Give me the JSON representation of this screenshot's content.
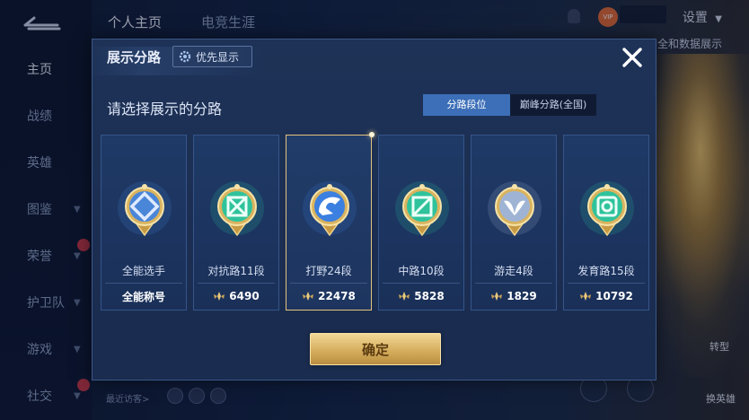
{
  "background": {
    "top_tabs": [
      "个人主页",
      "电竞生涯"
    ],
    "settings_label": "设置",
    "ticker_text": "",
    "peek_text": "全和数据展示",
    "nav_items": [
      {
        "label": "主页",
        "active": true,
        "chevron": false,
        "new": false
      },
      {
        "label": "战绩",
        "active": false,
        "chevron": false,
        "new": false
      },
      {
        "label": "英雄",
        "active": false,
        "chevron": false,
        "new": false
      },
      {
        "label": "图鉴",
        "active": false,
        "chevron": true,
        "new": false
      },
      {
        "label": "荣誉",
        "active": false,
        "chevron": true,
        "new": true
      },
      {
        "label": "护卫队",
        "active": false,
        "chevron": true,
        "new": false
      },
      {
        "label": "游戏",
        "active": false,
        "chevron": true,
        "new": false
      },
      {
        "label": "社交",
        "active": false,
        "chevron": true,
        "new": true
      }
    ],
    "recent_visitors": "最近访客>",
    "bottom_right": [
      "转型",
      "换英雄"
    ]
  },
  "dialog": {
    "title": "展示分路",
    "priority_button": "优先显示",
    "subtitle": "请选择展示的分路",
    "segment": {
      "options": [
        "分路段位",
        "巅峰分路(全国)"
      ],
      "selected_index": 0
    },
    "cards": [
      {
        "name": "全能选手",
        "score": "全能称号",
        "icon": "all-round-emblem-icon",
        "has_symbol": false,
        "selected": false,
        "accent": "#4a86d8"
      },
      {
        "name": "对抗路11段",
        "score": "6490",
        "icon": "clash-lane-emblem-icon",
        "has_symbol": true,
        "selected": false,
        "accent": "#2fc39c"
      },
      {
        "name": "打野24段",
        "score": "22478",
        "icon": "jungle-emblem-icon",
        "has_symbol": true,
        "selected": true,
        "accent": "#3b7fe0"
      },
      {
        "name": "中路10段",
        "score": "5828",
        "icon": "mid-lane-emblem-icon",
        "has_symbol": true,
        "selected": false,
        "accent": "#2fc39c"
      },
      {
        "name": "游走4段",
        "score": "1829",
        "icon": "roam-emblem-icon",
        "has_symbol": true,
        "selected": false,
        "accent": "#9fb4d4"
      },
      {
        "name": "发育路15段",
        "score": "10792",
        "icon": "farm-lane-emblem-icon",
        "has_symbol": true,
        "selected": false,
        "accent": "#2fc39c"
      }
    ],
    "confirm_label": "确定"
  },
  "colors": {
    "dialog_bg": "#1e3257",
    "segment_active": "#3c6fb8",
    "selected_border": "#e6c27d",
    "confirm_gold": "#d6ae5e"
  }
}
